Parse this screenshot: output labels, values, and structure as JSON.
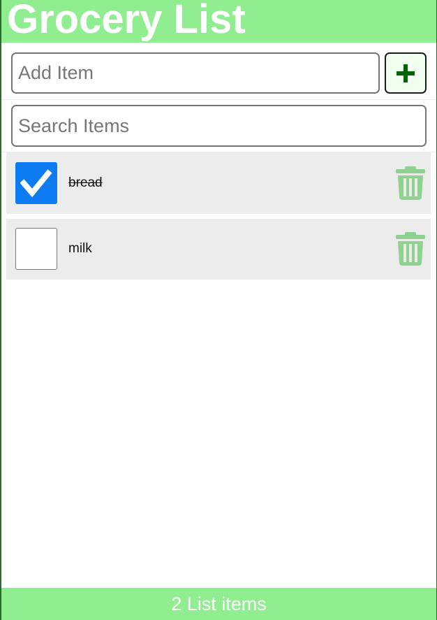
{
  "header": {
    "title": "Grocery List"
  },
  "add_form": {
    "placeholder": "Add Item",
    "value": "",
    "button_icon": "plus-icon"
  },
  "search": {
    "placeholder": "Search Items",
    "value": ""
  },
  "items": [
    {
      "label": "bread",
      "checked": true,
      "delete_icon": "trash-icon"
    },
    {
      "label": "milk",
      "checked": false,
      "delete_icon": "trash-icon"
    }
  ],
  "footer": {
    "count_text": "2 List items"
  },
  "colors": {
    "accent": "#90ee90",
    "checkbox_checked": "#0d7cf2",
    "trash": "#8fd18f",
    "add_icon": "#006400",
    "item_background": "#ececec"
  }
}
